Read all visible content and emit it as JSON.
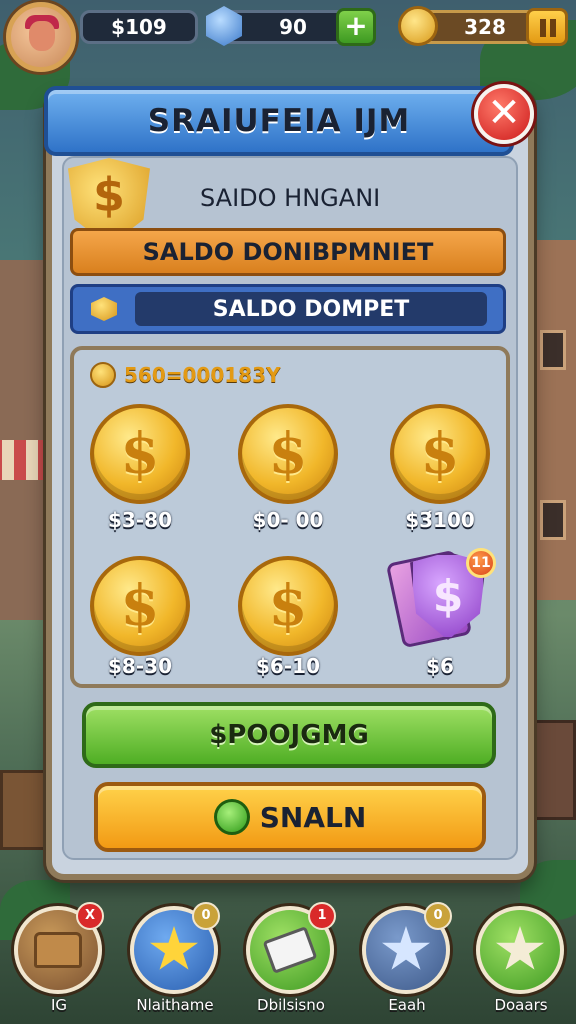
{
  "topbar": {
    "money": "$109",
    "gems": "90",
    "coins": "328"
  },
  "panel": {
    "title": "SRAIUFEIA IJM",
    "balance_label": "SAIDO HNGANI",
    "orange_bar_text": "SALDO DONIBPMNIET",
    "blue_bar_text": "SALDO DOMPET",
    "grid_header": "560=000183Y",
    "items": [
      {
        "price": "$3-80"
      },
      {
        "price": "$0- 00"
      },
      {
        "price": "$3́100"
      },
      {
        "price": "$8-30"
      },
      {
        "price": "$6-10"
      },
      {
        "price": "$6"
      }
    ],
    "gem_badge": "11",
    "buy_button": "$POOJGMG",
    "action_button": "SNALN"
  },
  "bottom_nav": [
    {
      "label": "IG",
      "badge": "X",
      "icon": "chest-icon"
    },
    {
      "label": "Nlaithame",
      "badge": "0",
      "icon": "star-icon"
    },
    {
      "label": "Dbilsisno",
      "badge": "1",
      "icon": "card-icon"
    },
    {
      "label": "Eaah",
      "badge": "0",
      "icon": "star-icon"
    },
    {
      "label": "Doaars",
      "badge": "",
      "icon": "star-icon"
    }
  ],
  "colors": {
    "panel_border": "#8f7a5a",
    "title_banner": "#2f73c8",
    "coin_gold": "#f1b72a",
    "green_button": "#4fae24",
    "orange_button": "#f29a14",
    "close_red": "#cc1a1a"
  }
}
